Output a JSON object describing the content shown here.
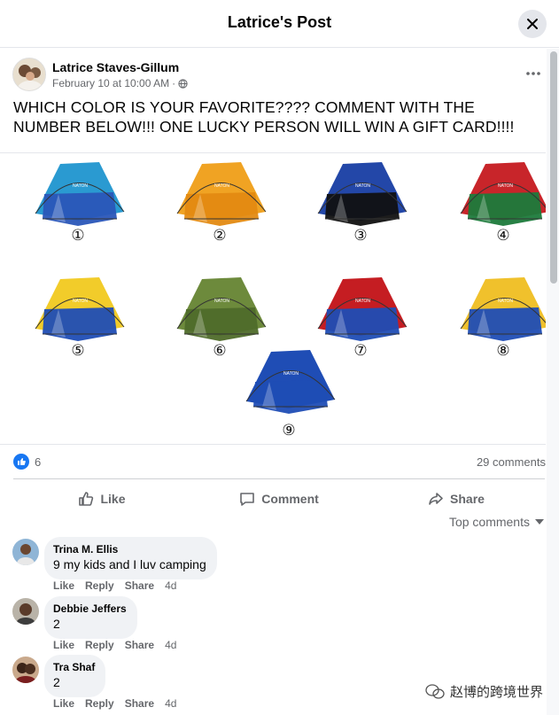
{
  "header": {
    "title": "Latrice's Post"
  },
  "post": {
    "author": "Latrice Staves-Gillum",
    "timestamp": "February 10 at 10:00 AM",
    "text": "WHICH COLOR IS YOUR FAVORITE???? COMMENT WITH THE NUMBER BELOW!!! ONE LUCKY PERSON WILL WIN A GIFT CARD!!!!",
    "options": [
      "①",
      "②",
      "③",
      "④",
      "⑤",
      "⑥",
      "⑦",
      "⑧",
      "⑨"
    ],
    "tent_colors": {
      "1": [
        "#2a9ad1",
        "#2a56b8"
      ],
      "2": [
        "#f0a323",
        "#e38a12"
      ],
      "3": [
        "#2347a8",
        "#111111"
      ],
      "4": [
        "#c8252a",
        "#1c7a3b"
      ],
      "5": [
        "#f2cc2a",
        "#1f4db5"
      ],
      "6": [
        "#6d8a3c",
        "#4f6b2a"
      ],
      "7": [
        "#c51d22",
        "#1f4db5"
      ],
      "8": [
        "#f0c12c",
        "#1f4db5"
      ],
      "9": [
        "#1f4db5",
        "#1f4db5"
      ]
    },
    "tent_brand": "NATON"
  },
  "stats": {
    "reactions": "6",
    "comments": "29 comments"
  },
  "actions": {
    "like": "Like",
    "comment": "Comment",
    "share": "Share"
  },
  "sort": {
    "label": "Top comments"
  },
  "comments": [
    {
      "name": "Trina M. Ellis",
      "text": "9 my kids and I luv camping",
      "time": "4d"
    },
    {
      "name": "Debbie Jeffers",
      "text": "2",
      "time": "4d"
    },
    {
      "name": "Tra Shaf",
      "text": "2",
      "time": "4d"
    }
  ],
  "comment_actions": {
    "like": "Like",
    "reply": "Reply",
    "share": "Share"
  },
  "watermark": {
    "text": "赵博的跨境世界"
  },
  "colors": {
    "accent": "#1877f2",
    "secondary_text": "#65676b",
    "bubble": "#f0f2f5"
  }
}
